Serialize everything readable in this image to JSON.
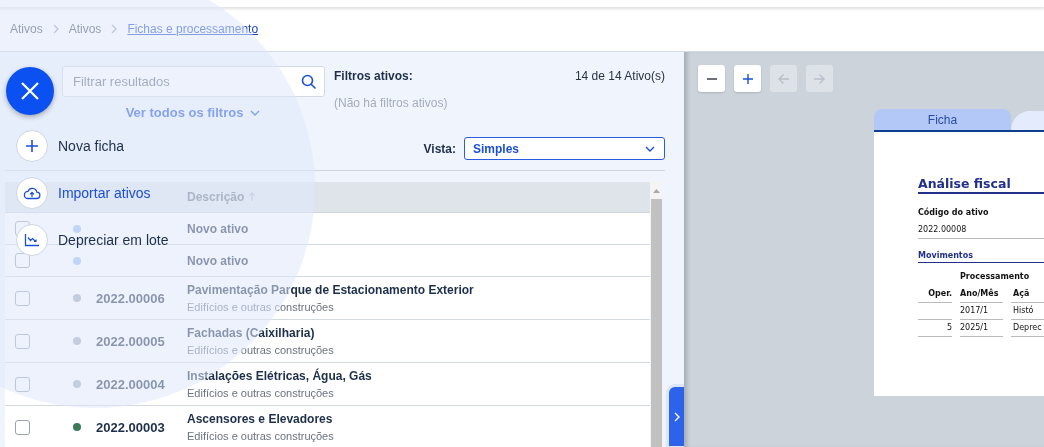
{
  "breadcrumb": [
    {
      "label": "Ativos",
      "current": false
    },
    {
      "label": "Ativos",
      "current": false
    },
    {
      "label": "Fichas e processamento",
      "current": true
    }
  ],
  "filters": {
    "search": {
      "placeholder": "Filtrar resultados"
    },
    "all_filters": "Ver todos os filtros",
    "active_title": "Filtros ativos:",
    "active_empty": "(Não há filtros ativos)",
    "count": "14 de 14 Ativo(s)"
  },
  "view": {
    "label": "Vista:",
    "value": "Simples"
  },
  "table": {
    "columns": [
      "Descrição"
    ],
    "rows": [
      {
        "checked": false,
        "title": "Novo ativo"
      },
      {
        "checked": false,
        "title": "Novo ativo"
      },
      {
        "checked": false,
        "code": "2022.00006",
        "title": "Pavimentação Parque de Estacionamento Exterior",
        "category": "Edifícios e outras construções"
      },
      {
        "checked": false,
        "code": "2022.00005",
        "title": "Fachadas (Caixilharia)",
        "category": "Edifícios e outras construções"
      },
      {
        "checked": false,
        "code": "2022.00004",
        "title": "Instalações Elétricas, Água, Gás",
        "category": "Edifícios e outras construções"
      },
      {
        "checked": false,
        "color": "#3d7a58",
        "code": "2022.00003",
        "title": "Ascensores e Elevadores",
        "category": "Edifícios e outras construções"
      }
    ]
  },
  "viewer": {
    "toolbar": [
      {
        "kind": "zoom-out",
        "disabled": false
      },
      {
        "kind": "zoom-in",
        "disabled": false
      },
      {
        "kind": "back",
        "disabled": true
      },
      {
        "kind": "forward",
        "disabled": true
      }
    ]
  },
  "document": {
    "tabs": [
      {
        "label": "Ficha",
        "selected": true
      },
      {
        "selected": false
      }
    ],
    "title": "Análise fiscal",
    "field_label": "Código do ativo",
    "field_value": "2022.00008",
    "section": "Movimentos",
    "movements": {
      "group": "Processamento",
      "columns": [
        "Oper.",
        "Ano/Mês",
        "Açã"
      ],
      "rows": [
        {
          "year": "2017/1",
          "action": "Histó"
        },
        {
          "oper": "5",
          "year": "2025/1",
          "action": "Deprec"
        }
      ]
    }
  },
  "speed_dial": {
    "open": true,
    "items": [
      {
        "kind": "plus",
        "label": "Nova ficha",
        "hovered": false
      },
      {
        "kind": "upload",
        "label": "Importar ativos",
        "hovered": true
      },
      {
        "kind": "chart",
        "label": "Depreciar em lote",
        "hovered": false
      }
    ]
  }
}
